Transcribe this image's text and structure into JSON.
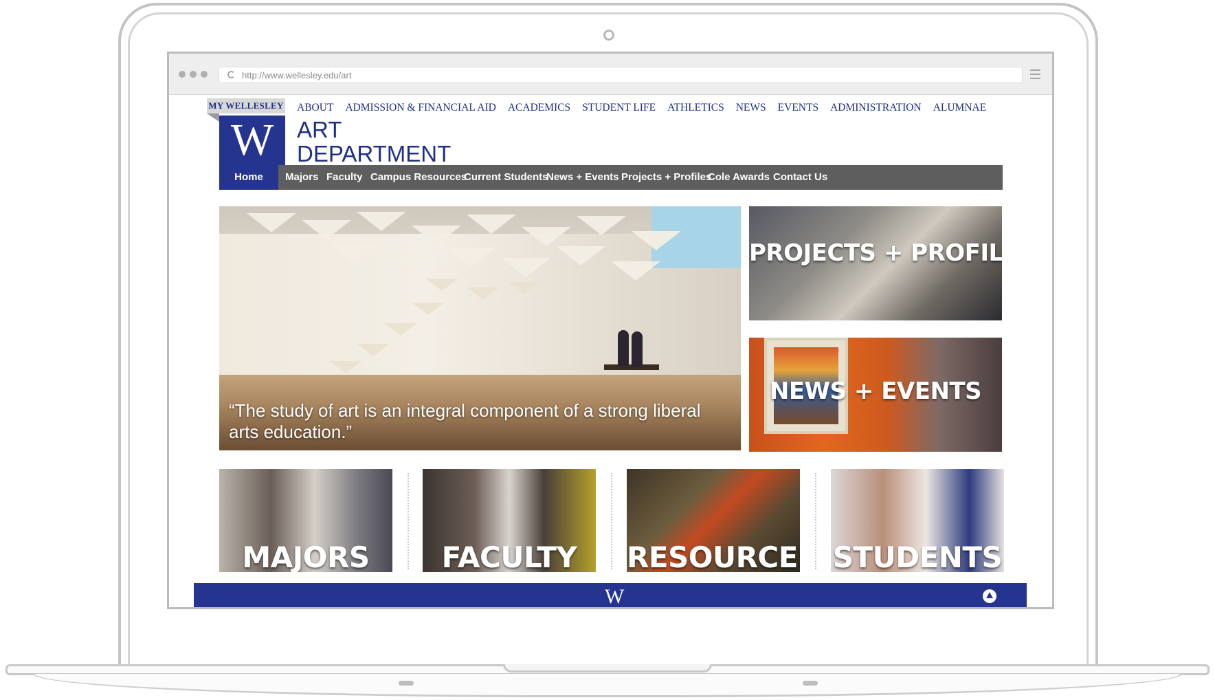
{
  "browser": {
    "url": "http://www.wellesley.edu/art"
  },
  "header": {
    "my_wellesley": "MY WELLESLEY",
    "logo_letter": "W",
    "title_line1": "ART",
    "title_line2": "DEPARTMENT",
    "top_nav": [
      "ABOUT",
      "ADMISSION & FINANCIAL AID",
      "ACADEMICS",
      "STUDENT LIFE",
      "ATHLETICS",
      "NEWS",
      "EVENTS",
      "ADMINISTRATION",
      "ALUMNAE"
    ]
  },
  "main_nav": {
    "items": [
      "Home",
      "Majors",
      "Faculty",
      "Campus Resources",
      "Current Students",
      "News + Events",
      "Projects + Profiles",
      "Cole Awards",
      "Contact Us"
    ],
    "active": "Home"
  },
  "hero": {
    "quote": "“The study of art is an integral component of a strong liberal arts education.”"
  },
  "feature_tiles": {
    "projects": "PROJECTS + PROFILES",
    "news": "NEWS + EVENTS"
  },
  "bottom_tiles": {
    "majors": "MAJORS",
    "faculty": "FACULTY",
    "resources": "RESOURCES",
    "students": "STUDENTS"
  },
  "footer": {
    "logo_letter": "W"
  },
  "colors": {
    "brand_blue": "#24348f",
    "nav_gray": "#5e5e5e"
  },
  "icons": [
    "reload-icon",
    "menu-icon",
    "back-to-top-icon"
  ]
}
